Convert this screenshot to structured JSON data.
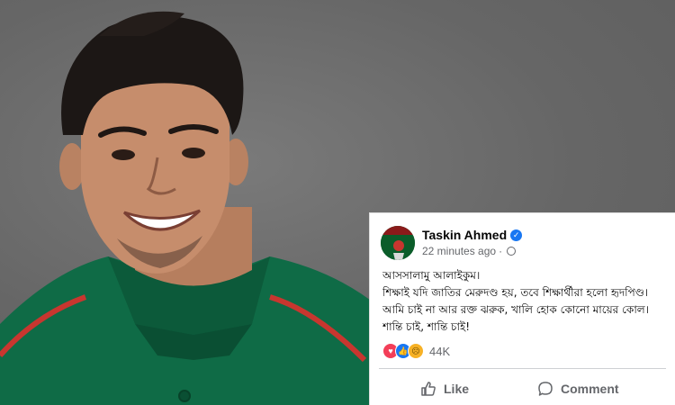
{
  "post": {
    "author": "Taskin Ahmed",
    "time": "22 minutes ago",
    "lines": [
      "আসসালামু আলাইকুম।",
      "শিক্ষাই যদি জাতির মেরুদণ্ড হয়, তবে শিক্ষার্থীরা হলো হৃদপিণ্ড।",
      "আমি চাই না আর রক্ত ঝরুক, খালি হোক কোনো মায়ের কোল।",
      "শান্তি চাই, শান্তি চাই!"
    ],
    "reaction_count": "44K",
    "reactions": [
      "love",
      "like",
      "sad"
    ]
  },
  "actions": {
    "like_label": "Like",
    "comment_label": "Comment"
  },
  "colors": {
    "facebook_blue": "#1877f2",
    "jersey_green": "#0f6b46",
    "jersey_red_stripe": "#c8362f",
    "background_gray": "#6b6b6b"
  },
  "icons": {
    "verified": "verified-badge-icon",
    "privacy": "globe-icon",
    "like": "thumbs-up-icon",
    "comment": "speech-bubble-icon"
  }
}
